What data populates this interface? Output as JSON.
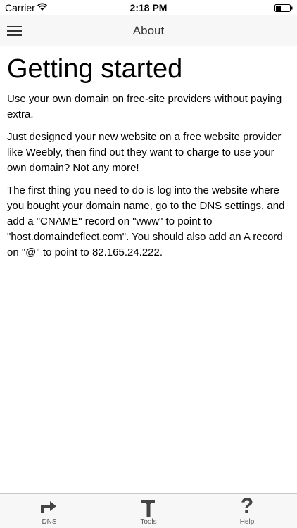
{
  "status_bar": {
    "carrier": "Carrier",
    "time": "2:18 PM"
  },
  "nav": {
    "title": "About",
    "menu_icon": "hamburger-menu-icon"
  },
  "content": {
    "heading": "Getting started",
    "paragraphs": [
      "Use your own domain on free-site providers without paying extra.",
      "Just designed your new website on a free website provider like Weebly, then find out they want to charge to use your own domain? Not any more!",
      "The first thing you need to do is log into the website where you bought your domain name, go to the DNS settings, and add a \"CNAME\" record on \"www\" to point to \"host.domaindeflect.com\". You should also add an A record on \"@\" to point to 82.165.24.222."
    ]
  },
  "tabs": [
    {
      "label": "DNS",
      "icon": "redirect-arrow-icon"
    },
    {
      "label": "Tools",
      "icon": "hammer-icon"
    },
    {
      "label": "Help",
      "icon": "question-mark-icon",
      "glyph": "?"
    }
  ],
  "colors": {
    "bar_background": "#f7f7f7",
    "icon": "#444444"
  }
}
